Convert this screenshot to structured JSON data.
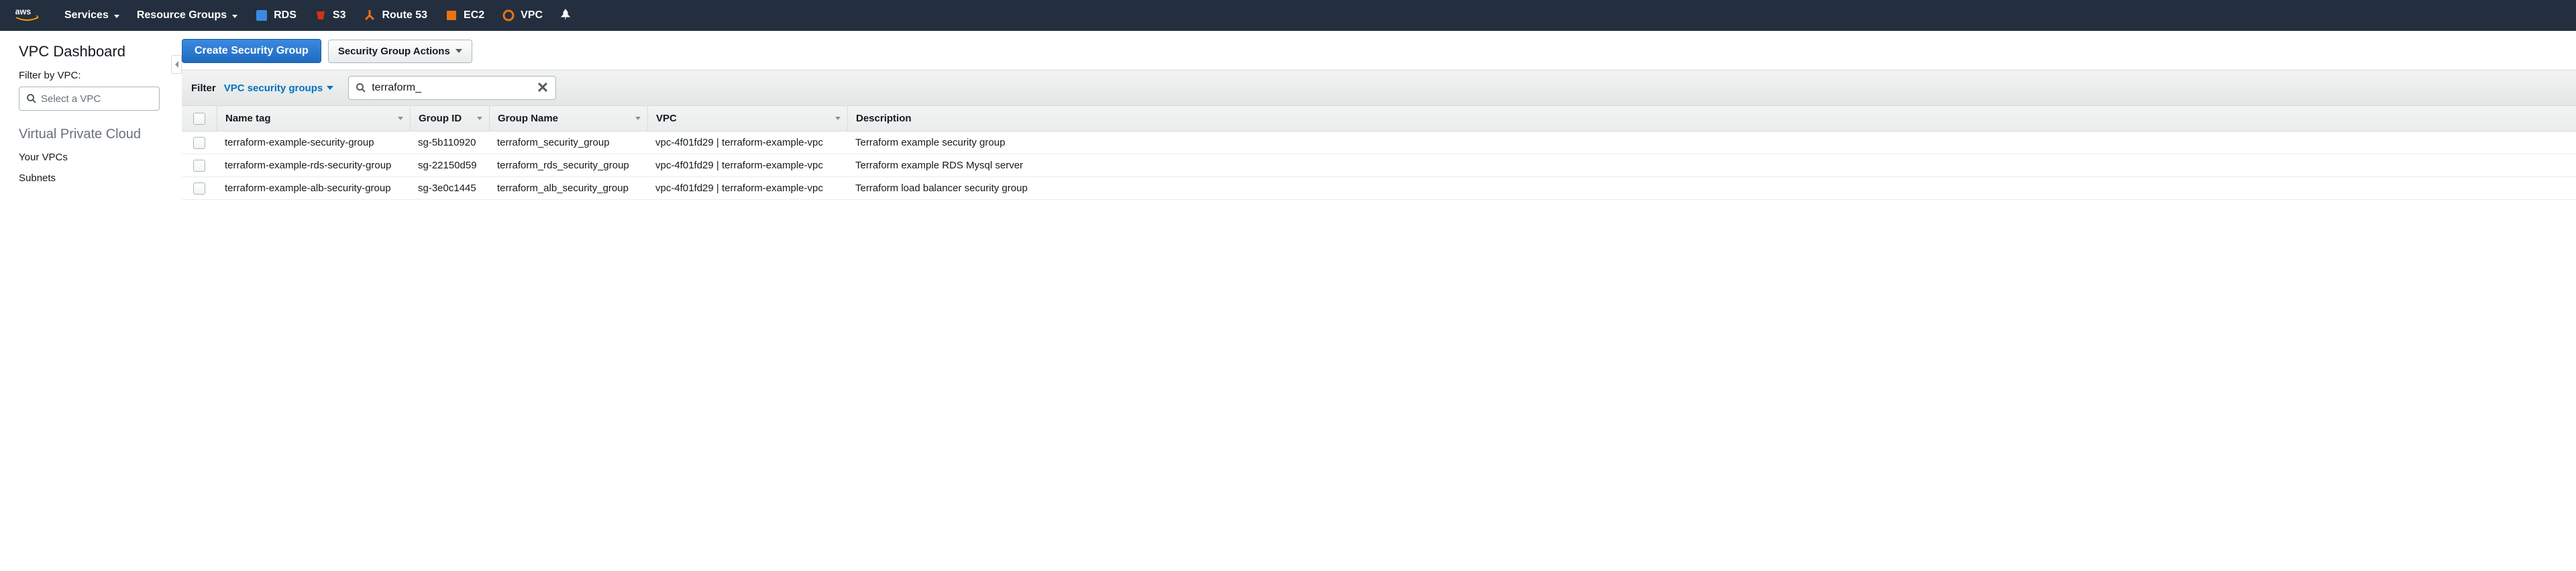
{
  "topnav": {
    "services": "Services",
    "resource_groups": "Resource Groups",
    "shortcuts": [
      {
        "label": "RDS",
        "color": "#3b8ae0",
        "icon": "rds"
      },
      {
        "label": "S3",
        "color": "#d13212",
        "icon": "s3"
      },
      {
        "label": "Route 53",
        "color": "#ec7211",
        "icon": "route53"
      },
      {
        "label": "EC2",
        "color": "#ec7211",
        "icon": "ec2"
      },
      {
        "label": "VPC",
        "color": "#ec7211",
        "icon": "vpc"
      }
    ]
  },
  "sidebar": {
    "title": "VPC Dashboard",
    "filter_label": "Filter by VPC:",
    "select_placeholder": "Select a VPC",
    "section_heading": "Virtual Private Cloud",
    "links": [
      "Your VPCs",
      "Subnets"
    ]
  },
  "actions": {
    "create": "Create Security Group",
    "sg_actions": "Security Group Actions"
  },
  "filter": {
    "label": "Filter",
    "dropdown": "VPC security groups",
    "search_value": "terraform_"
  },
  "table": {
    "headers": {
      "name_tag": "Name tag",
      "group_id": "Group ID",
      "group_name": "Group Name",
      "vpc": "VPC",
      "description": "Description"
    },
    "rows": [
      {
        "name_tag": "terraform-example-security-group",
        "group_id": "sg-5b110920",
        "group_name": "terraform_security_group",
        "vpc": "vpc-4f01fd29 | terraform-example-vpc",
        "description": "Terraform example security group"
      },
      {
        "name_tag": "terraform-example-rds-security-group",
        "group_id": "sg-22150d59",
        "group_name": "terraform_rds_security_group",
        "vpc": "vpc-4f01fd29 | terraform-example-vpc",
        "description": "Terraform example RDS Mysql server"
      },
      {
        "name_tag": "terraform-example-alb-security-group",
        "group_id": "sg-3e0c1445",
        "group_name": "terraform_alb_security_group",
        "vpc": "vpc-4f01fd29 | terraform-example-vpc",
        "description": "Terraform load balancer security group"
      }
    ]
  }
}
